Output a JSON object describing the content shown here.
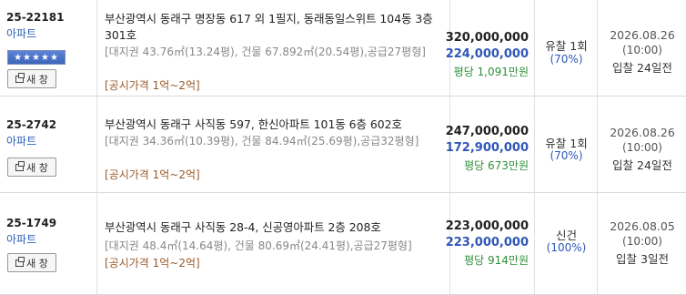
{
  "rows": [
    {
      "case_no": "25-22181",
      "type": "아파트",
      "stars": "★★★★★",
      "new_window": "새 창",
      "address": "부산광역시 동래구 명장동 617 외 1필지, 동래동일스위트 104동 3층 301호",
      "detail": "[대지권 43.76㎡(13.24평), 건물 67.892㎡(20.54평),공급27평형]",
      "notice": "[공시가격 1억~2억]",
      "appraisal": "320,000,000",
      "min_bid": "224,000,000",
      "per_pyeong": "평당 1,091만원",
      "status": "유찰 1회",
      "percent": "(70%)",
      "date": "2026.08.26",
      "time": "(10:00)",
      "d_day": "입찰 24일전"
    },
    {
      "case_no": "25-2742",
      "type": "아파트",
      "new_window": "새 창",
      "address": "부산광역시 동래구 사직동 597, 한신아파트 101동 6층 602호",
      "detail": "[대지권 34.36㎡(10.39평), 건물 84.94㎡(25.69평),공급32평형]",
      "notice": "[공시가격 1억~2억]",
      "appraisal": "247,000,000",
      "min_bid": "172,900,000",
      "per_pyeong": "평당 673만원",
      "status": "유찰 1회",
      "percent": "(70%)",
      "date": "2026.08.26",
      "time": "(10:00)",
      "d_day": "입찰 24일전"
    },
    {
      "case_no": "25-1749",
      "type": "아파트",
      "new_window": "새 창",
      "address": "부산광역시 동래구 사직동 28-4, 신공영아파트 2층 208호",
      "detail": "[대지권 48.4㎡(14.64평), 건물 80.69㎡(24.41평),공급27평형]",
      "notice": "[공시가격 1억~2억]",
      "appraisal": "223,000,000",
      "min_bid": "223,000,000",
      "per_pyeong": "평당 914만원",
      "status": "신건",
      "percent": "(100%)",
      "date": "2026.08.05",
      "time": "(10:00)",
      "d_day": "입찰 3일전"
    }
  ]
}
